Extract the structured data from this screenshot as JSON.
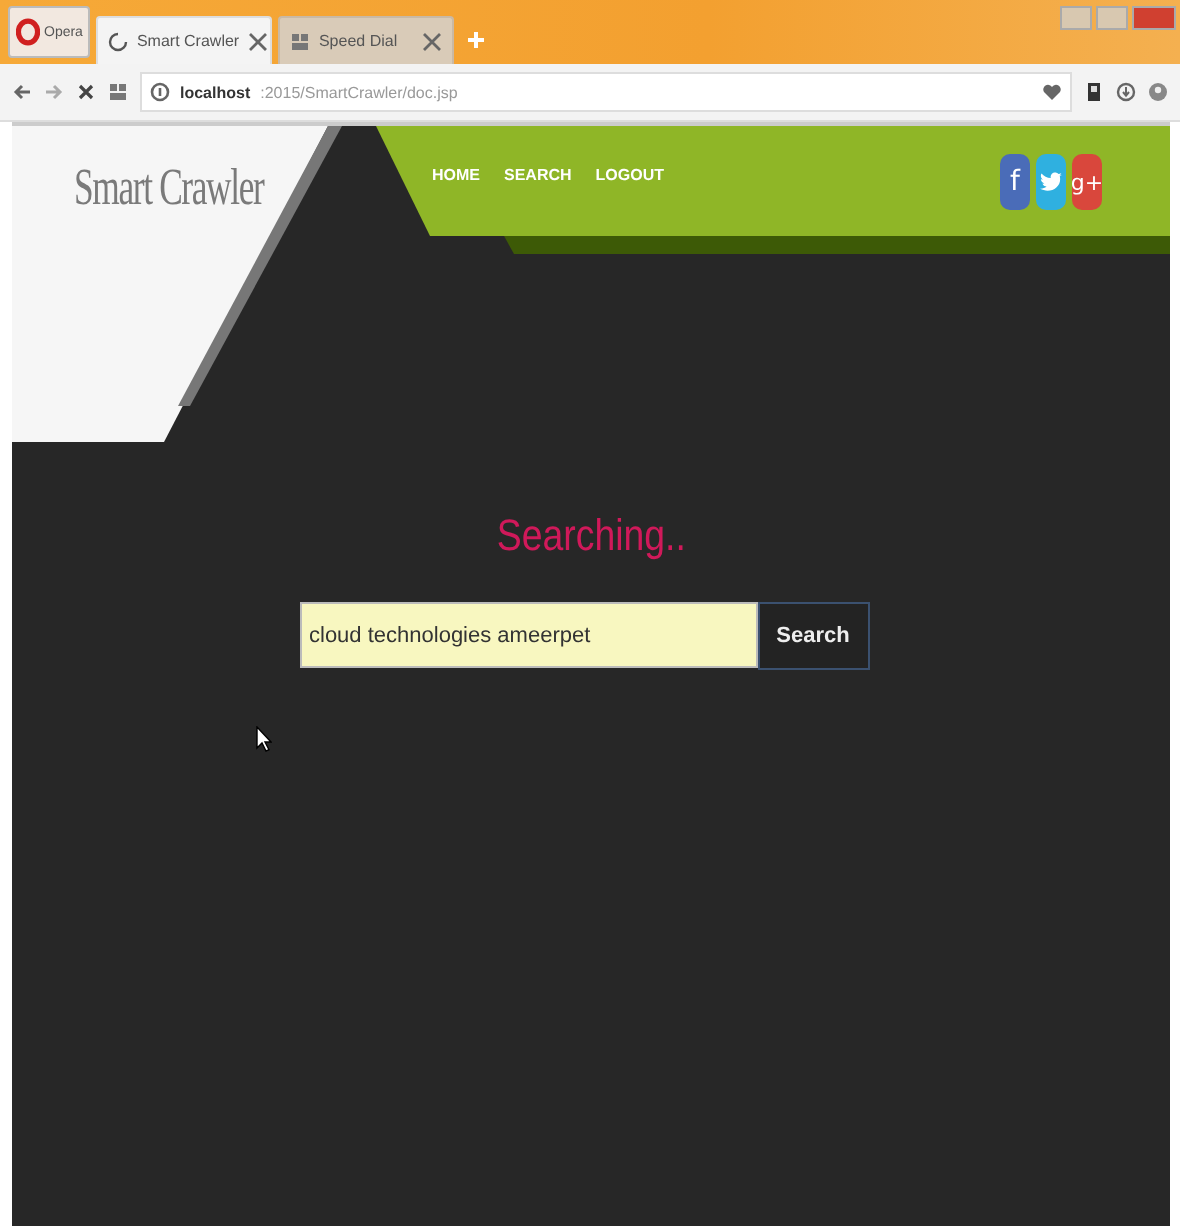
{
  "browser": {
    "menu_button": "Opera",
    "tabs": [
      {
        "label": "Smart Crawler",
        "selected": true
      },
      {
        "label": "Speed Dial",
        "selected": false
      }
    ],
    "address": {
      "host": "localhost",
      "path": ":2015/SmartCrawler/doc.jsp"
    }
  },
  "site": {
    "logo": "Smart Crawler",
    "nav": [
      {
        "label": "HOME"
      },
      {
        "label": "SEARCH"
      },
      {
        "label": "LOGOUT"
      }
    ],
    "social": [
      {
        "kind": "facebook",
        "label": "f"
      },
      {
        "kind": "twitter"
      },
      {
        "kind": "googleplus",
        "label": "g+"
      }
    ]
  },
  "heading": "Searching..",
  "search": {
    "value": "cloud technologies ameerpet",
    "button": "Search"
  }
}
